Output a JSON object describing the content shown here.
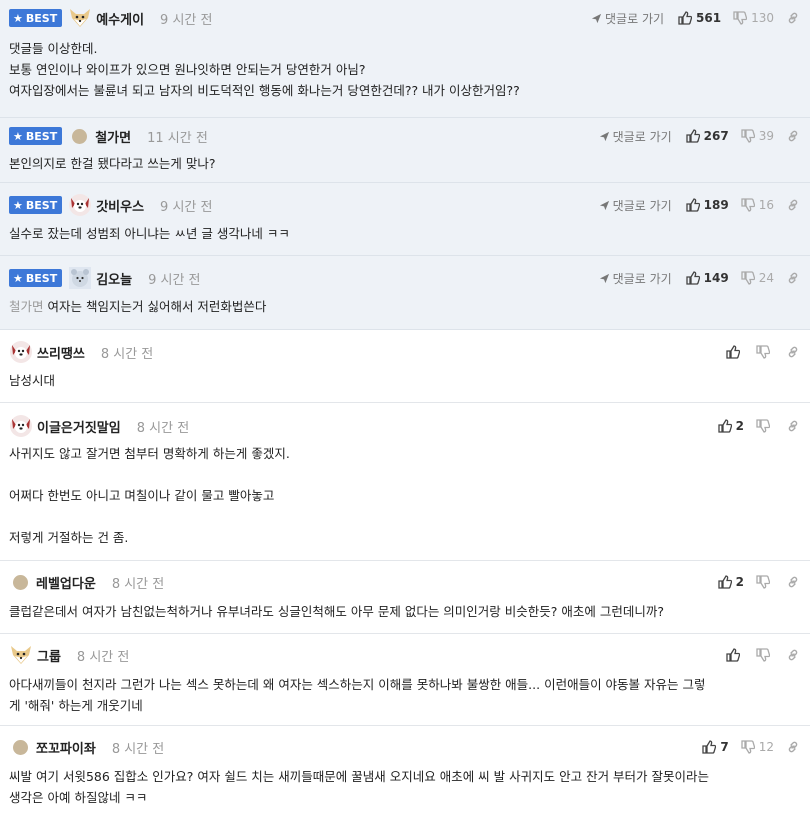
{
  "best_badge": "BEST",
  "reply_label": "댓글로 가기",
  "comments": [
    {
      "nick": "예수게이",
      "time": "9 시간 전",
      "up": "561",
      "down": "130",
      "lines": [
        "댓글들 이상한데.",
        "보통 연인이나 와이프가 있으면 원나잇하면 안되는거 당연한거 아님?",
        "여자입장에서는 불륜녀 되고 남자의 비도덕적인 행동에 화나는거 당연한건데?? 내가 이상한거임??"
      ]
    },
    {
      "nick": "철가면",
      "time": "11 시간 전",
      "up": "267",
      "down": "39",
      "lines": [
        "본인의지로 한걸 됐다라고 쓰는게 맞나?"
      ]
    },
    {
      "nick": "갓비우스",
      "time": "9 시간 전",
      "up": "189",
      "down": "16",
      "lines": [
        "실수로 잤는데 성범죄 아니냐는 ㅆ년 글 생각나네 ㅋㅋ"
      ]
    },
    {
      "nick": "김오늘",
      "time": "9 시간 전",
      "up": "149",
      "down": "24",
      "mention": "철가면",
      "lines": [
        "여자는 책임지는거 싫어해서 저런화법쓴다"
      ]
    },
    {
      "nick": "쓰리땡쓰",
      "time": "8 시간 전",
      "up": "",
      "lines": [
        "남성시대"
      ]
    },
    {
      "nick": "이글은거짓말임",
      "time": "8 시간 전",
      "up": "2",
      "lines": [
        "사귀지도 않고 잘거면 첨부터 명확하게 하는게 좋겠지.",
        "",
        "어쩌다 한번도 아니고 며칠이나 같이 물고 빨아놓고",
        "",
        "저렇게 거절하는 건 좀."
      ]
    },
    {
      "nick": "레벨업다운",
      "time": "8 시간 전",
      "up": "2",
      "lines": [
        "클럽같은데서 여자가 남친없는척하거나 유부녀라도 싱글인척해도 아무 문제 없다는 의미인거랑 비슷한듯? 애초에 그런데니까?"
      ]
    },
    {
      "nick": "그룹",
      "time": "8 시간 전",
      "up": "",
      "lines": [
        "아다새끼들이 천지라 그런가 나는 섹스 못하는데 왜 여자는 섹스하는지 이해를 못하나봐 불쌍한 애들... 이런애들이 야동볼 자유는 그렇",
        "게 '해줘' 하는게 개웃기네"
      ]
    },
    {
      "nick": "쪼꼬파이좌",
      "time": "8 시간 전",
      "up": "7",
      "down": "12",
      "lines": [
        "씨발 여기 서윗586 집합소 인가요? 여자 쉴드 치는 새끼들때문에 꿀냄새 오지네요 애초에 씨 발 사귀지도 안고 잔거 부터가 잘못이라는",
        "생각은 아예 하질않네 ㅋㅋ"
      ]
    }
  ]
}
